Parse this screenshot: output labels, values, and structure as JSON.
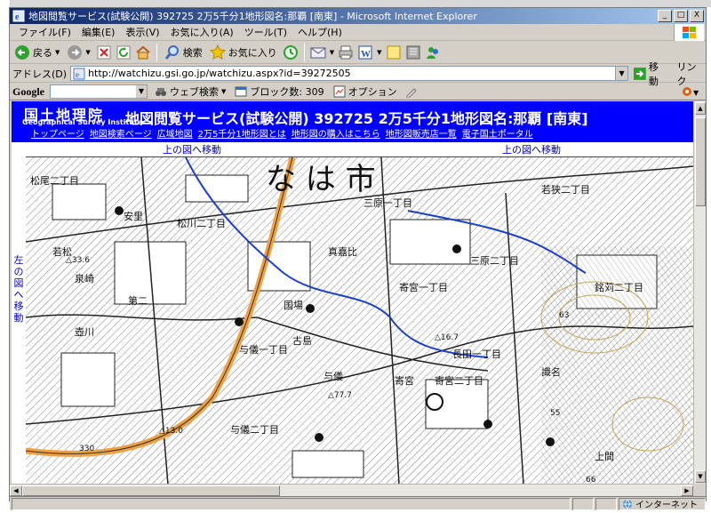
{
  "window": {
    "title": "地図閲覧サービス(試験公開) 392725 2万5千分1地形図名:那覇 [南東] - Microsoft Internet Explorer",
    "min_label": "_",
    "max_label": "□",
    "close_label": "X"
  },
  "menu": {
    "items": [
      "ファイル(F)",
      "編集(E)",
      "表示(V)",
      "お気に入り(A)",
      "ツール(T)",
      "ヘルプ(H)"
    ]
  },
  "toolbar": {
    "back_label": "戻る",
    "search_label": "検索",
    "favorites_label": "お気に入り"
  },
  "address": {
    "label": "アドレス(D)",
    "url": "http://watchizu.gsi.go.jp/watchizu.aspx?id=39272505",
    "go_label": "移動",
    "links_label": "リンク"
  },
  "google": {
    "logo": "Google",
    "web_search_label": "ウェブ検索",
    "blocked_label": "ブロック数: 309",
    "options_label": "オプション"
  },
  "page": {
    "logo_jp": "国土地理院",
    "logo_en": "Geographical Survey Institute",
    "title": "地図閲覧サービス(試験公開) 392725 2万5千分1地形図名:那覇 [南東]",
    "links": [
      "トップページ",
      "地図検索ページ",
      "広域地図",
      "2万5千分1地形図とは",
      "地形図の購入はこちら",
      "地形図販売店一覧",
      "電子国土ポータル"
    ],
    "nav_up_left": "上の図へ移動",
    "nav_up_right": "上の図へ移動",
    "nav_left": "左の図へ移動"
  },
  "map": {
    "city_label": "な は 市",
    "place_labels": [
      "松尾二丁目",
      "松川二丁目",
      "三原一丁目",
      "三原二丁目",
      "若狭二丁目",
      "寄宮一丁目",
      "寄宮二丁目",
      "与儀二丁目",
      "真嘉比",
      "古島",
      "銘苅二丁目",
      "安里",
      "長田一丁目",
      "上間",
      "識名",
      "第二",
      "国場",
      "与儀",
      "寄宮",
      "若松",
      "泉崎",
      "壺川",
      "与儀一丁目",
      "330",
      "△33.6",
      "△13.0",
      "△16.7",
      "△77.7",
      "63",
      "55",
      "66"
    ],
    "colors": {
      "road": "#f0a040",
      "river": "#1a3fcc",
      "ink": "#222222",
      "contour": "#c8a050"
    }
  },
  "status": {
    "zone_label": "インターネット"
  },
  "colors": {
    "title_gradient_start": "#0a246a",
    "title_gradient_end": "#a6caf0",
    "gsi_blue": "#0000ff",
    "link_blue": "#0000cc"
  }
}
